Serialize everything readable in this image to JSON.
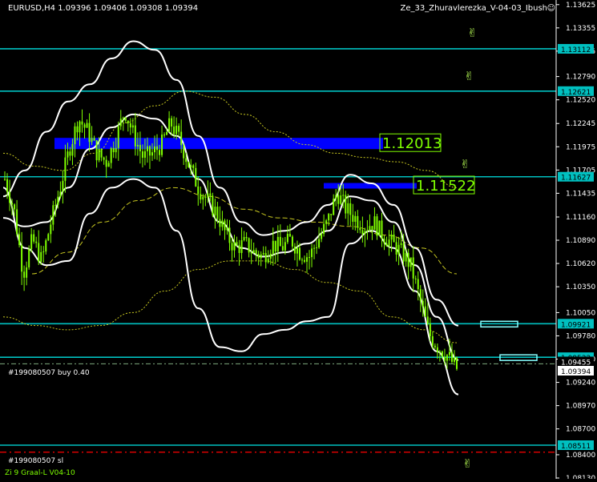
{
  "header": {
    "symbol_info": "EURUSD,H4  1.09396 1.09406 1.09308 1.09394",
    "indicator_name": "Ze_33_Zhuravlerezka_V-04-03_Ibush"
  },
  "footer": {
    "indicator_label": "Zi 9 Graal-L V04-10"
  },
  "order_labels": {
    "buy": "#199080507 buy 0.40",
    "sl": "#199080507 sl"
  },
  "colors": {
    "background": "#000000",
    "candle": "#7fff00",
    "hline": "#00c0c0",
    "band": "#ffffff",
    "ma_dotted": "#c8c820",
    "zone": "#0000ff",
    "level_text": "#7fff00",
    "sl_line": "#ff0000",
    "axis_text": "#ffffff",
    "axis_box": "#00c0c0"
  },
  "chart_data": {
    "type": "candlestick",
    "symbol": "EURUSD",
    "timeframe": "H4",
    "ylim": [
      1.0813,
      1.1366
    ],
    "y_ticks": [
      "1.13625",
      "1.13355",
      "1.13085",
      "1.12790",
      "1.12520",
      "1.12245",
      "1.11975",
      "1.11705",
      "1.11435",
      "1.11160",
      "1.10890",
      "1.10620",
      "1.10350",
      "1.10050",
      "1.09780",
      "1.09510",
      "1.09240",
      "1.08970",
      "1.08700",
      "1.08400",
      "1.08130"
    ],
    "horizontal_levels": [
      {
        "price": 1.13112,
        "label": "1.13112"
      },
      {
        "price": 1.12621,
        "label": "1.12621"
      },
      {
        "price": 1.11627,
        "label": "1.11627"
      },
      {
        "price": 1.09921,
        "label": "1.09921"
      },
      {
        "price": 1.09532,
        "label": "1.09532"
      },
      {
        "price": 1.08511,
        "label": "1.08511"
      }
    ],
    "current_price": {
      "value": 1.09394,
      "label": "1.09394"
    },
    "order_price": {
      "value": 1.09455,
      "label": "1.09455"
    },
    "sl_price": 1.0843,
    "zones": [
      {
        "price": 1.12013,
        "label": "1.12013"
      },
      {
        "price": 1.11522,
        "label": "1.11522"
      }
    ],
    "series": [
      {
        "kind": "closes",
        "values": [
          1.116,
          1.1125,
          1.105,
          1.109,
          1.1065,
          1.111,
          1.115,
          1.1195,
          1.123,
          1.1215,
          1.119,
          1.118,
          1.1205,
          1.124,
          1.121,
          1.1185,
          1.119,
          1.12,
          1.1225,
          1.1205,
          1.1175,
          1.115,
          1.1135,
          1.112,
          1.1095,
          1.108,
          1.1085,
          1.1075,
          1.107,
          1.1085,
          1.108,
          1.109,
          1.1075,
          1.107,
          1.109,
          1.111,
          1.1145,
          1.1125,
          1.1115,
          1.1105,
          1.111,
          1.1095,
          1.1085,
          1.1075,
          1.106,
          1.102,
          1.098,
          1.0965,
          1.0955,
          1.094
        ]
      },
      {
        "kind": "upper_band",
        "values": [
          1.114,
          1.117,
          1.1215,
          1.125,
          1.127,
          1.13,
          1.132,
          1.131,
          1.1275,
          1.121,
          1.115,
          1.111,
          1.1095,
          1.11,
          1.111,
          1.113,
          1.1165,
          1.1155,
          1.113,
          1.108,
          1.102,
          1.099
        ]
      },
      {
        "kind": "middle_band",
        "values": [
          1.1115,
          1.1105,
          1.111,
          1.115,
          1.1195,
          1.122,
          1.1235,
          1.123,
          1.121,
          1.116,
          1.111,
          1.108,
          1.107,
          1.1075,
          1.1085,
          1.11,
          1.114,
          1.1135,
          1.111,
          1.106,
          1.1,
          1.095
        ]
      },
      {
        "kind": "lower_band",
        "values": [
          1.115,
          1.108,
          1.106,
          1.1065,
          1.112,
          1.115,
          1.116,
          1.115,
          1.11,
          1.101,
          1.0965,
          1.096,
          1.098,
          1.0985,
          1.0995,
          1.1,
          1.1085,
          1.11,
          1.108,
          1.103,
          1.096,
          1.091
        ]
      },
      {
        "kind": "dotted_ma_upper",
        "values": [
          1.119,
          1.1175,
          1.117,
          1.119,
          1.1225,
          1.1245,
          1.1262,
          1.1255,
          1.1235,
          1.1215,
          1.12,
          1.119,
          1.1185,
          1.118,
          1.117,
          1.115
        ]
      },
      {
        "kind": "dotted_ma_lower",
        "values": [
          1.1,
          1.099,
          1.0985,
          1.099,
          1.1005,
          1.103,
          1.1055,
          1.1065,
          1.1065,
          1.1055,
          1.104,
          1.103,
          1.1,
          1.0985,
          1.097
        ]
      },
      {
        "kind": "dashed_ma",
        "values": [
          1.105,
          1.1075,
          1.111,
          1.1135,
          1.115,
          1.114,
          1.1125,
          1.1115,
          1.111,
          1.1105,
          1.1095,
          1.108,
          1.105
        ]
      }
    ]
  }
}
